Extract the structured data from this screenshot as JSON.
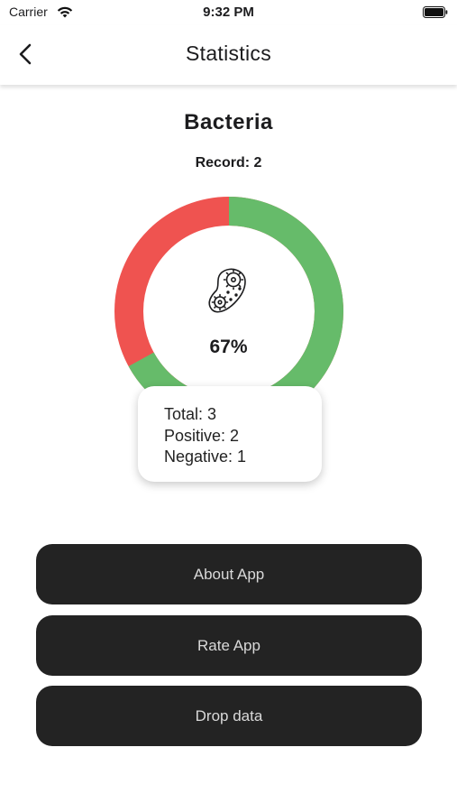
{
  "status_bar": {
    "carrier": "Carrier",
    "time": "9:32 PM"
  },
  "nav": {
    "title": "Statistics",
    "back_icon": "chevron-left-icon"
  },
  "stats": {
    "name": "Bacteria",
    "record_text": "Record: 2",
    "percent_text": "67%",
    "icon": "bacteria-icon",
    "tooltip": {
      "total": "Total: 3",
      "positive": "Positive: 2",
      "negative": "Negative: 1"
    },
    "ring": {
      "positive_fraction": 0.67,
      "positive_color": "#66bb6a",
      "negative_color": "#ef5350"
    }
  },
  "buttons": {
    "about": "About App",
    "rate": "Rate App",
    "drop": "Drop data"
  }
}
